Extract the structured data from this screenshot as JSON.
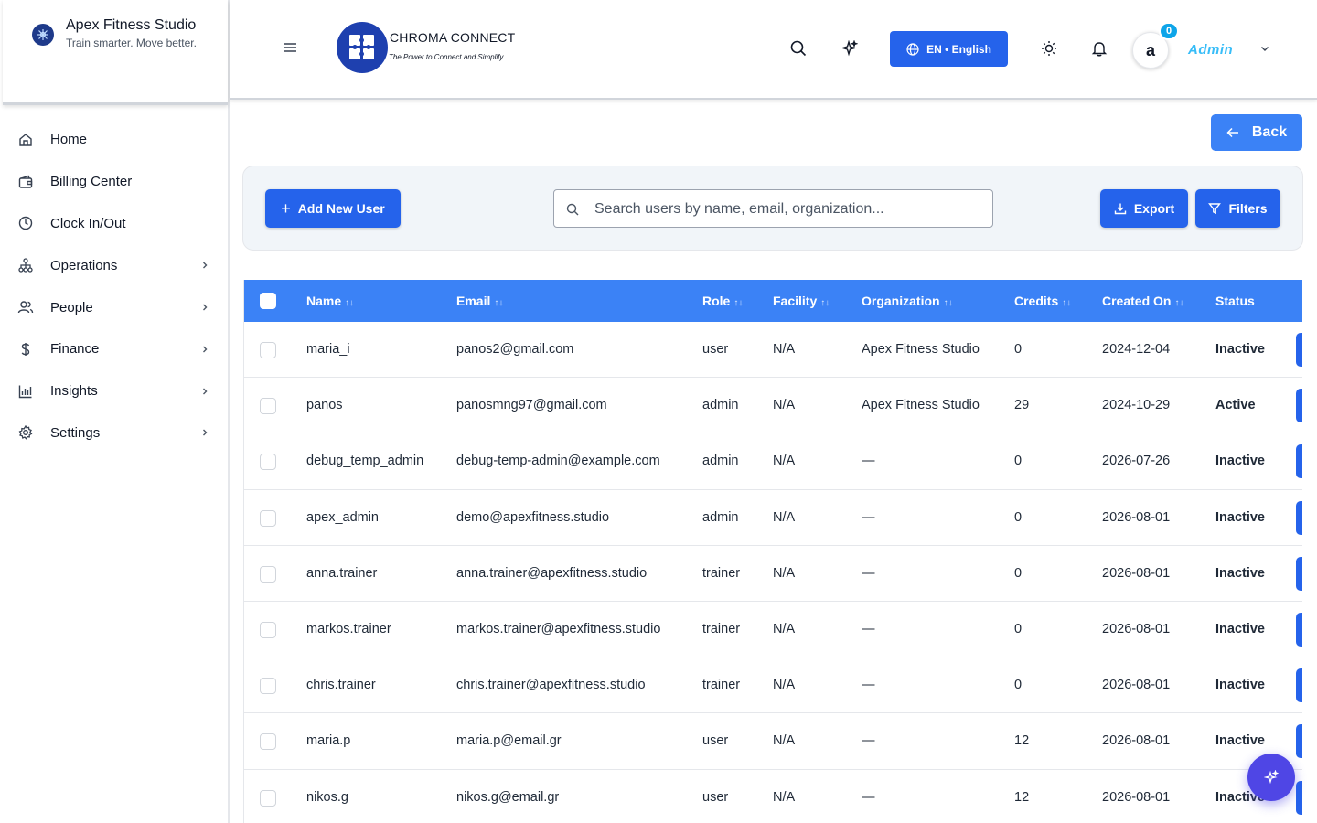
{
  "brand": {
    "name": "Apex Fitness Studio",
    "tagline": "Train smarter. Move better."
  },
  "sidebar": {
    "items": [
      {
        "label": "Home",
        "icon": "home-icon"
      },
      {
        "label": "Billing Center",
        "icon": "wallet-icon"
      },
      {
        "label": "Clock In/Out",
        "icon": "clock-icon"
      },
      {
        "label": "Operations",
        "icon": "hierarchy-icon"
      },
      {
        "label": "People",
        "icon": "users-icon"
      },
      {
        "label": "Finance",
        "icon": "dollar-icon"
      },
      {
        "label": "Insights",
        "icon": "bar-chart-icon"
      },
      {
        "label": "Settings",
        "icon": "gear-icon"
      }
    ]
  },
  "header": {
    "logo_title": "CHROMA CONNECT",
    "logo_subtitle": "The Power to Connect and Simplify",
    "language_label": "EN • English",
    "notification_count": "0",
    "avatar_letter": "a",
    "user_name": "Admin"
  },
  "page": {
    "back_label": "Back"
  },
  "toolbar": {
    "add_user_label": "Add New User",
    "search_placeholder": "Search users by name, email, organization...",
    "export_label": "Export",
    "filters_label": "Filters"
  },
  "table": {
    "columns": {
      "name": "Name",
      "email": "Email",
      "role": "Role",
      "facility": "Facility",
      "organization": "Organization",
      "credits": "Credits",
      "created_on": "Created On",
      "status": "Status"
    },
    "sort_glyph": "↑↓",
    "rows": [
      {
        "name": "maria_i",
        "email": "panos2@gmail.com",
        "role": "user",
        "facility": "N/A",
        "organization": "Apex Fitness Studio",
        "credits": "0",
        "created_on": "2024-12-04",
        "status": "Inactive"
      },
      {
        "name": "panos",
        "email": "panosmng97@gmail.com",
        "role": "admin",
        "facility": "N/A",
        "organization": "Apex Fitness Studio",
        "credits": "29",
        "created_on": "2024-10-29",
        "status": "Active"
      },
      {
        "name": "debug_temp_admin",
        "email": "debug-temp-admin@example.com",
        "role": "admin",
        "facility": "N/A",
        "organization": "—",
        "credits": "0",
        "created_on": "2026-07-26",
        "status": "Inactive"
      },
      {
        "name": "apex_admin",
        "email": "demo@apexfitness.studio",
        "role": "admin",
        "facility": "N/A",
        "organization": "—",
        "credits": "0",
        "created_on": "2026-08-01",
        "status": "Inactive"
      },
      {
        "name": "anna.trainer",
        "email": "anna.trainer@apexfitness.studio",
        "role": "trainer",
        "facility": "N/A",
        "organization": "—",
        "credits": "0",
        "created_on": "2026-08-01",
        "status": "Inactive"
      },
      {
        "name": "markos.trainer",
        "email": "markos.trainer@apexfitness.studio",
        "role": "trainer",
        "facility": "N/A",
        "organization": "—",
        "credits": "0",
        "created_on": "2026-08-01",
        "status": "Inactive"
      },
      {
        "name": "chris.trainer",
        "email": "chris.trainer@apexfitness.studio",
        "role": "trainer",
        "facility": "N/A",
        "organization": "—",
        "credits": "0",
        "created_on": "2026-08-01",
        "status": "Inactive"
      },
      {
        "name": "maria.p",
        "email": "maria.p@email.gr",
        "role": "user",
        "facility": "N/A",
        "organization": "—",
        "credits": "12",
        "created_on": "2026-08-01",
        "status": "Inactive"
      },
      {
        "name": "nikos.g",
        "email": "nikos.g@email.gr",
        "role": "user",
        "facility": "N/A",
        "organization": "—",
        "credits": "12",
        "created_on": "2026-08-01",
        "status": "Inactive"
      }
    ]
  },
  "colors": {
    "primary": "#2563eb",
    "table_header": "#3b82f6",
    "fab": "#4f46e5",
    "badge": "#0ea5e9",
    "user_name": "#38bdf8"
  }
}
